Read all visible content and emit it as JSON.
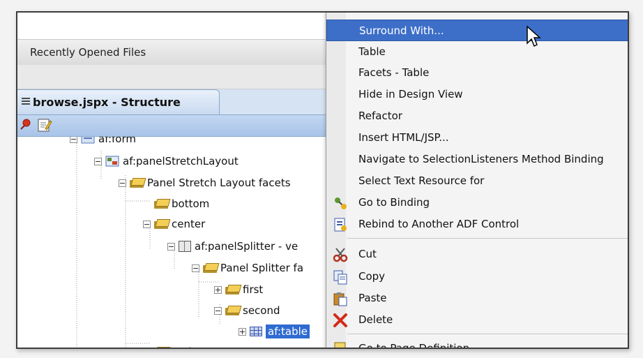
{
  "ide": {
    "recent_files_label": "Recently Opened Files",
    "panel_tab_title": "browse.jspx - Structure"
  },
  "tree": {
    "nodes": [
      {
        "label": "af:form",
        "level": 0,
        "icon": "form-icon"
      },
      {
        "label": "af:panelStretchLayout",
        "level": 1,
        "icon": "component-icon"
      },
      {
        "label": "Panel Stretch Layout facets",
        "level": 2,
        "icon": "folder-icon"
      },
      {
        "label": "bottom",
        "level": 3,
        "icon": "folder-icon"
      },
      {
        "label": "center",
        "level": 3,
        "icon": "folder-icon"
      },
      {
        "label": "af:panelSplitter - ve",
        "level": 4,
        "icon": "splitter-icon"
      },
      {
        "label": "Panel Splitter fa",
        "level": 5,
        "icon": "folder-icon"
      },
      {
        "label": "first",
        "level": 6,
        "icon": "folder-icon"
      },
      {
        "label": "second",
        "level": 6,
        "icon": "folder-icon"
      },
      {
        "label": "af:table",
        "level": 7,
        "icon": "table-icon",
        "selected": true
      },
      {
        "label": "end",
        "level": 3,
        "icon": "folder-icon"
      }
    ]
  },
  "context_menu": {
    "items": [
      {
        "label": "Surround With...",
        "highlighted": true
      },
      {
        "label": "Table"
      },
      {
        "label": "Facets - Table"
      },
      {
        "label": "Hide in Design View"
      },
      {
        "label": "Refactor"
      },
      {
        "label": "Insert HTML/JSP..."
      },
      {
        "label": "Navigate to SelectionListeners Method Binding"
      },
      {
        "label": "Select Text Resource for"
      },
      {
        "label": "Go to Binding",
        "icon": "binding-icon"
      },
      {
        "label": "Rebind to Another ADF Control",
        "icon": "rebind-icon"
      },
      {
        "label": "Cut",
        "icon": "scissors-icon"
      },
      {
        "label": "Copy",
        "icon": "copy-icon"
      },
      {
        "label": "Paste",
        "icon": "paste-icon"
      },
      {
        "label": "Delete",
        "icon": "delete-icon"
      },
      {
        "label": "Go to Page Definition",
        "icon": "page-def-icon"
      }
    ]
  },
  "colors": {
    "highlight": "#3d6fc9",
    "selection": "#2f6bd0"
  }
}
